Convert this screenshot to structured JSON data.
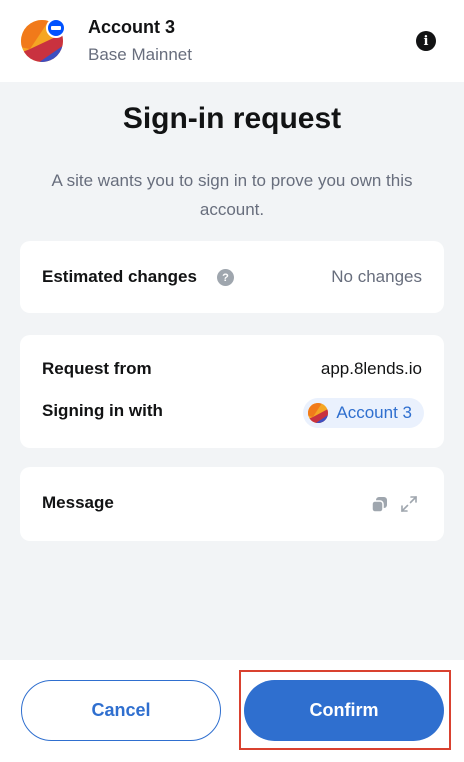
{
  "header": {
    "account_name": "Account 3",
    "network_name": "Base Mainnet",
    "info_icon": "info-icon",
    "info_glyph": "i"
  },
  "title": "Sign-in request",
  "subtitle": "A site wants you to sign in to prove you own this account.",
  "estimated_changes": {
    "label": "Estimated changes",
    "help_glyph": "?",
    "value": "No changes"
  },
  "request": {
    "from_label": "Request from",
    "from_value": "app.8lends.io",
    "signing_label": "Signing in with",
    "signing_account": "Account 3"
  },
  "message": {
    "label": "Message",
    "icons": [
      "copy-icon",
      "expand-icon"
    ]
  },
  "footer": {
    "cancel_label": "Cancel",
    "confirm_label": "Confirm"
  },
  "colors": {
    "primary": "#2f6fcf",
    "background": "#f2f4f6",
    "highlight": "#d9412f",
    "muted_text": "#686e7d"
  }
}
